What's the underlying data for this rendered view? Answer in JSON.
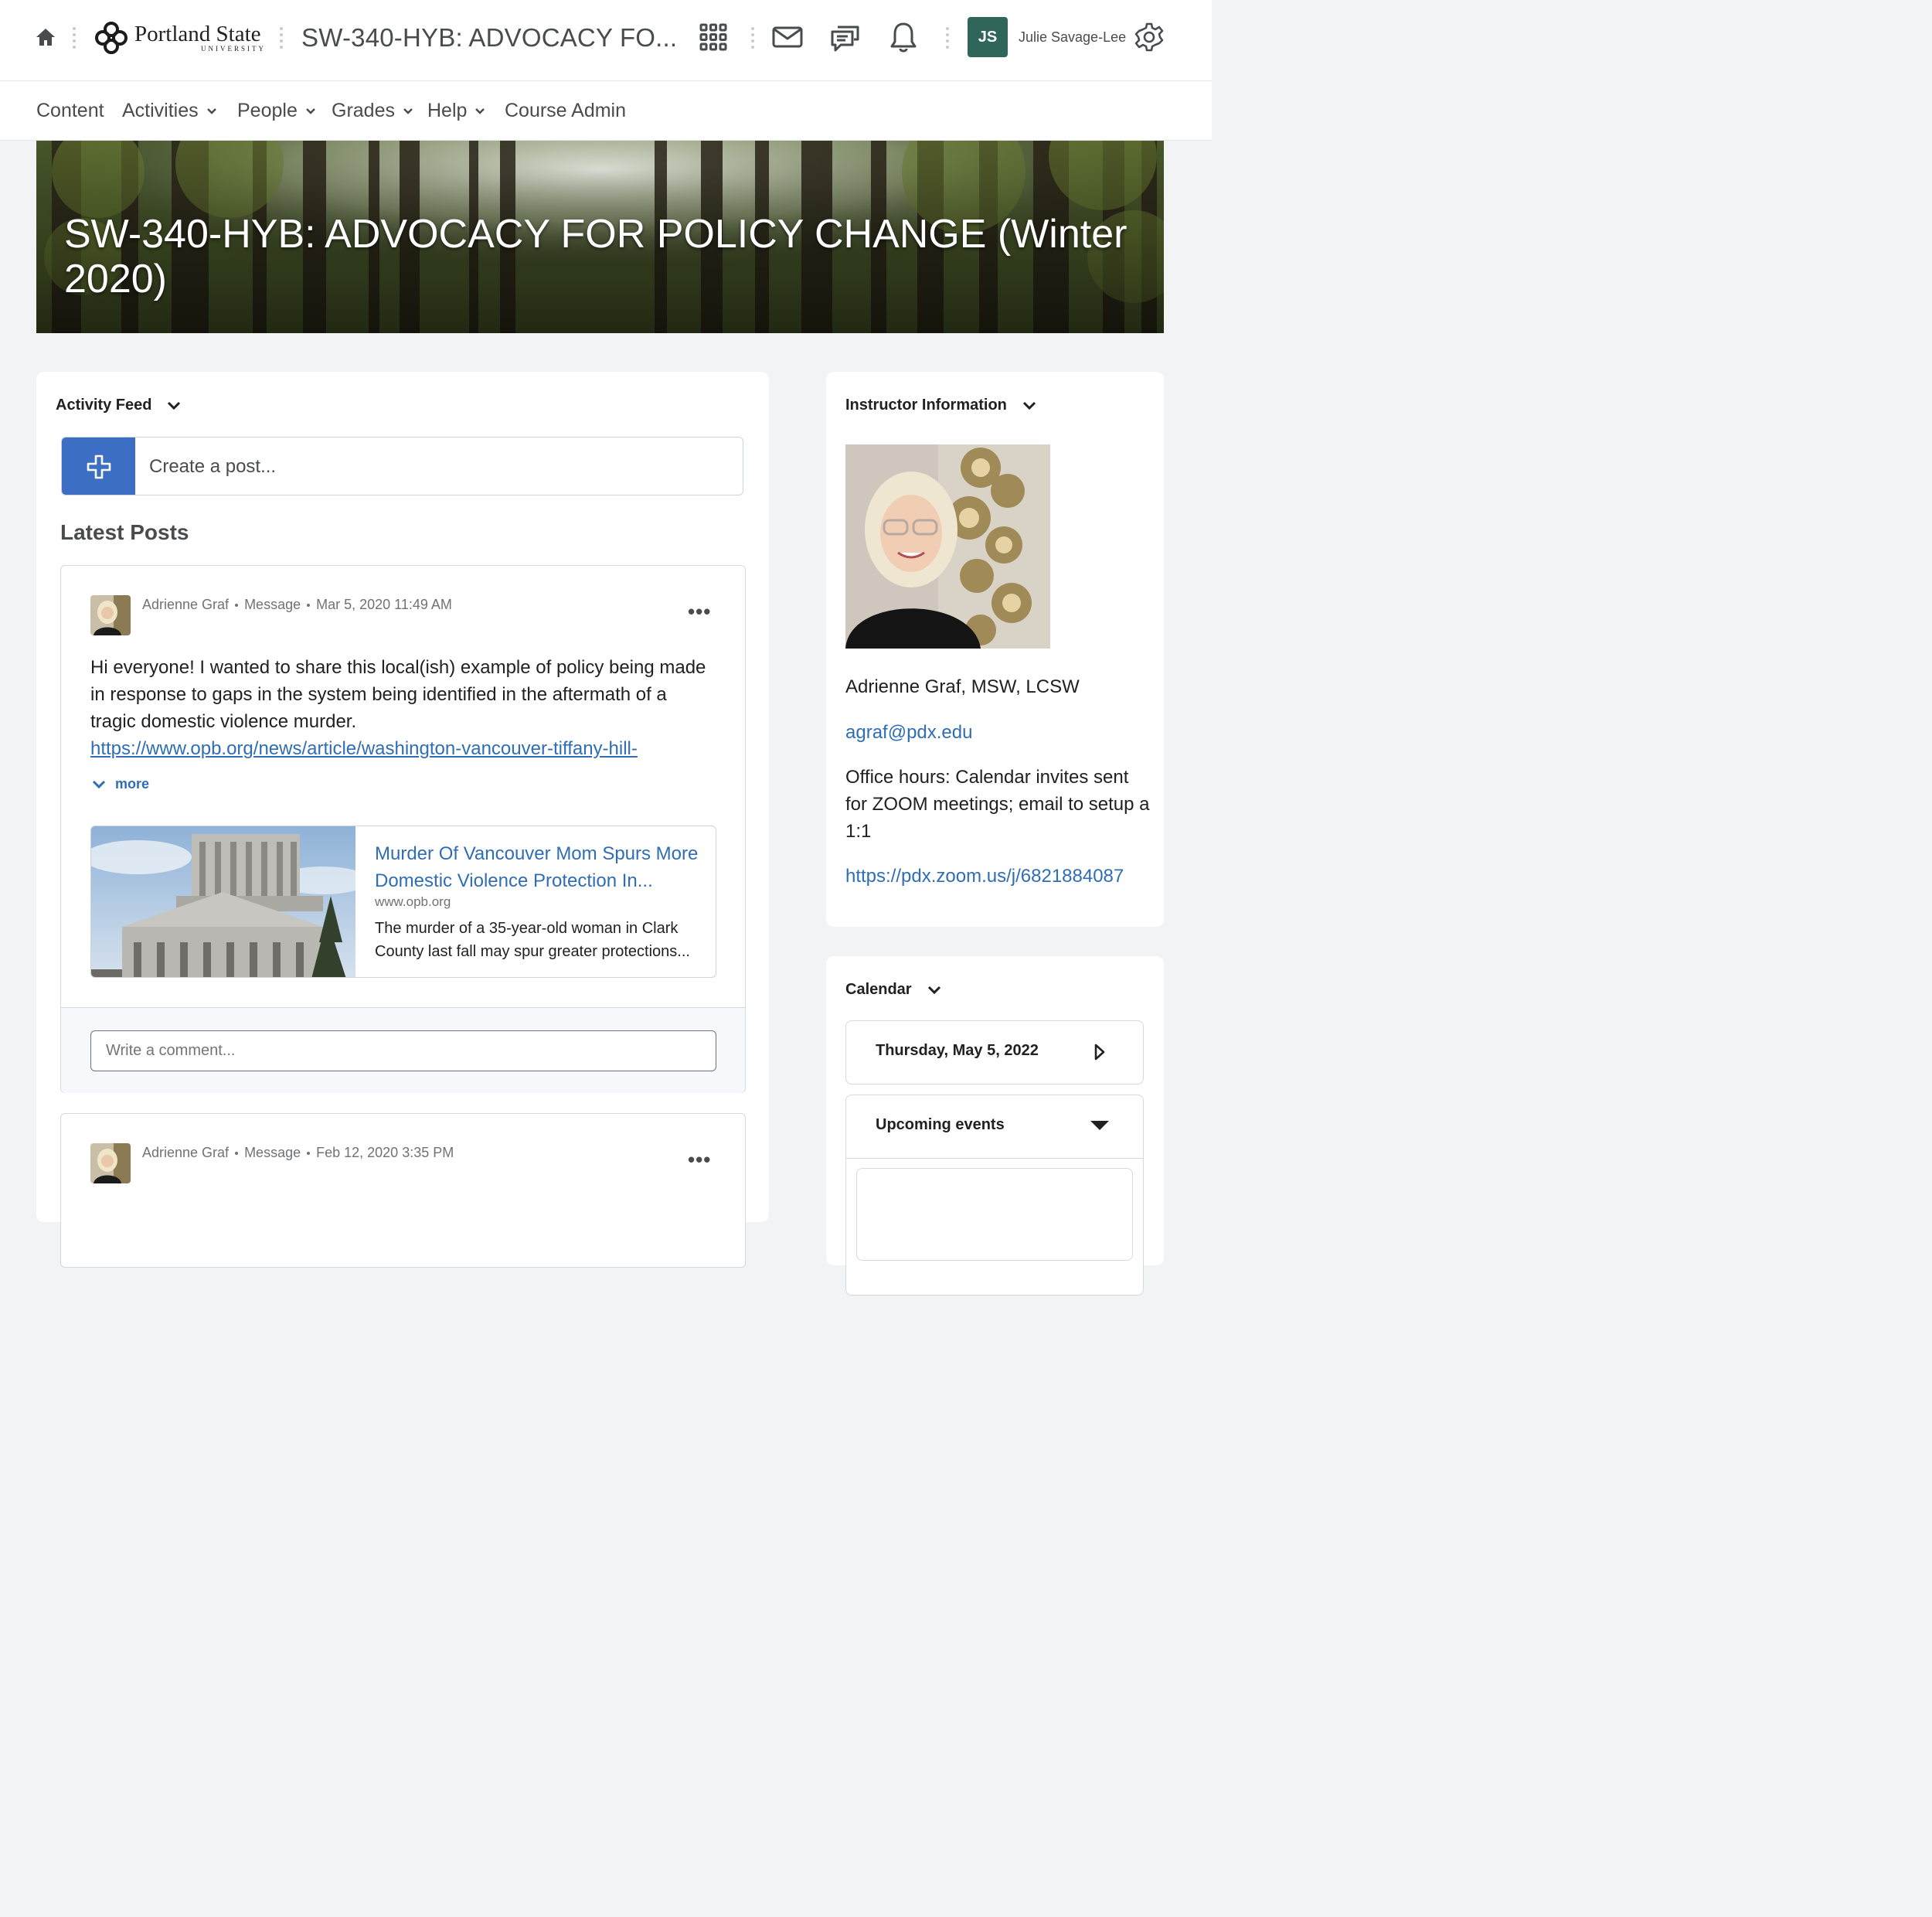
{
  "topbar": {
    "logo_main": "Portland State",
    "logo_sub": "UNIVERSITY",
    "course_title": "SW-340-HYB: ADVOCACY FO...",
    "user_initials": "JS",
    "user_name": "Julie Savage-Lee",
    "icons": [
      "home-icon",
      "waffle-icon",
      "mail-icon",
      "chat-icon",
      "bell-icon",
      "gear-icon"
    ]
  },
  "nav": {
    "items": [
      {
        "label": "Content",
        "dropdown": false
      },
      {
        "label": "Activities",
        "dropdown": true
      },
      {
        "label": "People",
        "dropdown": true
      },
      {
        "label": "Grades",
        "dropdown": true
      },
      {
        "label": "Help",
        "dropdown": true
      },
      {
        "label": "Course Admin",
        "dropdown": false
      }
    ]
  },
  "banner": {
    "title": "SW-340-HYB: ADVOCACY FOR POLICY CHANGE (Winter 2020)"
  },
  "activity_feed": {
    "heading": "Activity Feed",
    "create_post_placeholder": "Create a post...",
    "latest_posts_heading": "Latest Posts",
    "posts": [
      {
        "author": "Adrienne Graf",
        "type": "Message",
        "date": "Mar 5, 2020 11:49 AM",
        "body": "Hi everyone! I wanted to share this local(ish) example of policy being made in response to gaps in the system being identified in the aftermath of a tragic domestic violence murder.",
        "link": "https://www.opb.org/news/article/washington-vancouver-tiffany-hill-",
        "more_label": "more",
        "preview": {
          "title": "Murder Of Vancouver Mom Spurs More Domestic Violence Protection In...",
          "domain": "www.opb.org",
          "description": "The murder of a 35-year-old woman in Clark County last fall may spur greater protections..."
        },
        "comment_placeholder": "Write a comment..."
      },
      {
        "author": "Adrienne Graf",
        "type": "Message",
        "date": "Feb 12, 2020 3:35 PM"
      }
    ]
  },
  "instructor": {
    "heading": "Instructor Information",
    "name": "Adrienne Graf, MSW, LCSW",
    "email": "agraf@pdx.edu",
    "office_hours": "Office hours: Calendar invites sent for ZOOM meetings; email to setup a 1:1",
    "zoom_link": "https://pdx.zoom.us/j/6821884087"
  },
  "calendar": {
    "heading": "Calendar",
    "date": "Thursday, May 5, 2022",
    "upcoming_label": "Upcoming events"
  },
  "colors": {
    "accent_blue": "#3c6fc4",
    "avatar_green": "#2f6659",
    "link_blue": "#2f6db5"
  }
}
